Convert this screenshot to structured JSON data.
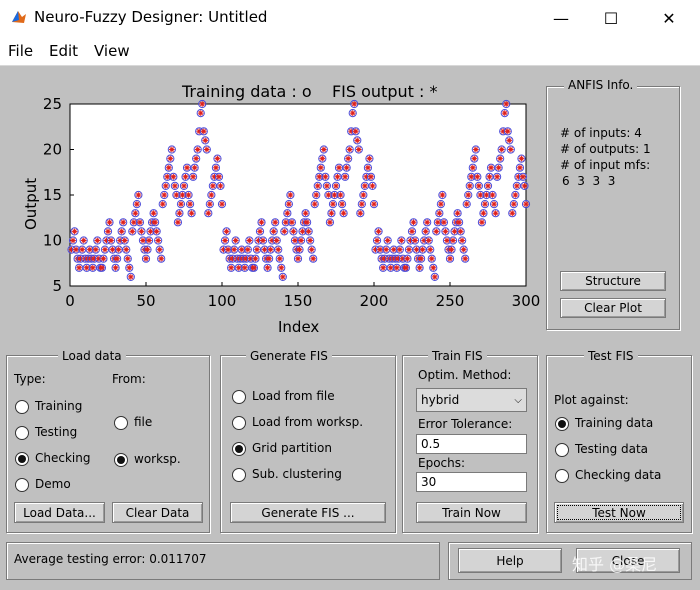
{
  "window": {
    "title": "Neuro-Fuzzy Designer: Untitled",
    "minimize_glyph": "—",
    "maximize_glyph": "☐",
    "close_glyph": "✕"
  },
  "menu": {
    "file": "File",
    "edit": "Edit",
    "view": "View"
  },
  "plot": {
    "title": "Training data : o    FIS output : *",
    "xlabel": "Index",
    "ylabel": "Output",
    "xticks": [
      "0",
      "50",
      "100",
      "150",
      "200",
      "250",
      "300"
    ],
    "yticks": [
      "5",
      "10",
      "15",
      "20",
      "25"
    ]
  },
  "chart_data": {
    "type": "scatter",
    "title": "Training data : o    FIS output : *",
    "xlabel": "Index",
    "ylabel": "Output",
    "xlim": [
      0,
      300
    ],
    "ylim": [
      5,
      25
    ],
    "grid": false,
    "period": 100,
    "pattern": [
      [
        9,
        10,
        11,
        9,
        8,
        7,
        8,
        9,
        10,
        8
      ],
      [
        7,
        8,
        9,
        8,
        7,
        8,
        9,
        10,
        8,
        7
      ],
      [
        7,
        8,
        9,
        10,
        11,
        12,
        10,
        9,
        8,
        7
      ],
      [
        8,
        9,
        10,
        11,
        12,
        10,
        9,
        8,
        7,
        6
      ],
      [
        11,
        12,
        13,
        14,
        15,
        12,
        11,
        10,
        9,
        8
      ],
      [
        9,
        10,
        11,
        12,
        13,
        12,
        11,
        10,
        9,
        8
      ],
      [
        14,
        15,
        16,
        17,
        18,
        19,
        20,
        17,
        16,
        15
      ],
      [
        12,
        13,
        14,
        15,
        16,
        17,
        18,
        15,
        14,
        13
      ],
      [
        17,
        18,
        19,
        20,
        22,
        24,
        25,
        22,
        21,
        20
      ],
      [
        13,
        14,
        15,
        16,
        17,
        18,
        19,
        17,
        16,
        14
      ]
    ],
    "series": [
      {
        "name": "Training data",
        "marker": "o",
        "color": "#4a4ad8"
      },
      {
        "name": "FIS output",
        "marker": "*",
        "color": "#e0201c"
      }
    ]
  },
  "anfis": {
    "title": "ANFIS Info.",
    "inputs": "# of inputs: 4",
    "outputs": "# of outputs: 1",
    "input_mfs": "# of input mfs:",
    "mfs_values": "6  3  3  3",
    "structure_btn": "Structure",
    "clear_plot_btn": "Clear Plot"
  },
  "load_data": {
    "title": "Load data",
    "type_label": "Type:",
    "from_label": "From:",
    "types": [
      {
        "label": "Training",
        "on": false
      },
      {
        "label": "Testing",
        "on": false
      },
      {
        "label": "Checking",
        "on": true
      },
      {
        "label": "Demo",
        "on": false
      }
    ],
    "from": [
      {
        "label": "file",
        "on": false
      },
      {
        "label": "worksp.",
        "on": true
      }
    ],
    "load_btn": "Load Data...",
    "clear_btn": "Clear Data"
  },
  "generate_fis": {
    "title": "Generate FIS",
    "options": [
      {
        "label": "Load from file",
        "on": false
      },
      {
        "label": "Load from worksp.",
        "on": false
      },
      {
        "label": "Grid partition",
        "on": true
      },
      {
        "label": "Sub. clustering",
        "on": false
      }
    ],
    "generate_btn": "Generate FIS ..."
  },
  "train_fis": {
    "title": "Train FIS",
    "optim_label": "Optim. Method:",
    "optim_value": "hybrid",
    "tol_label": "Error Tolerance:",
    "tol_value": "0.5",
    "epochs_label": "Epochs:",
    "epochs_value": "30",
    "train_btn": "Train Now"
  },
  "test_fis": {
    "title": "Test FIS",
    "plot_against": "Plot against:",
    "options": [
      {
        "label": "Training data",
        "on": true
      },
      {
        "label": "Testing data",
        "on": false
      },
      {
        "label": "Checking data",
        "on": false
      }
    ],
    "test_btn": "Test Now"
  },
  "status": {
    "text": "Average testing error: 0.011707"
  },
  "buttons": {
    "help": "Help",
    "close": "Close"
  },
  "watermark": "知乎 @桑尼"
}
